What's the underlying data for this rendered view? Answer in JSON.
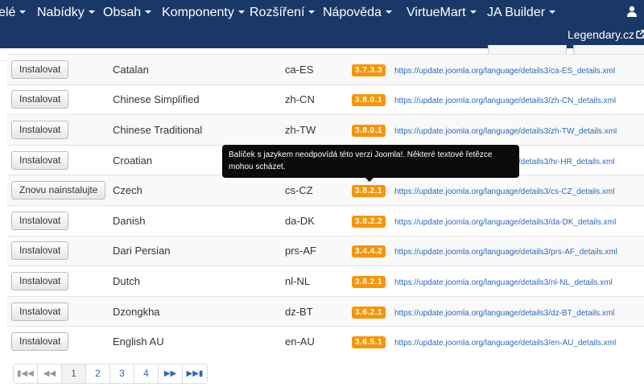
{
  "navbar": {
    "menu": [
      {
        "label": "elé",
        "caret": true
      },
      {
        "label": "Nabídky",
        "caret": true
      },
      {
        "label": "Obsah",
        "caret": true
      },
      {
        "label": "Komponenty",
        "caret": true
      },
      {
        "label": "Rozšíření",
        "caret": true
      },
      {
        "label": "Nápověda",
        "caret": true
      },
      {
        "label": "VirtueMart",
        "caret": true
      },
      {
        "label": "JA Builder",
        "caret": true
      }
    ],
    "user_icon": "user-icon",
    "site_link": "Legendary.cz",
    "site_link_icon": "external-link-icon"
  },
  "languages": [
    {
      "button": "Instalovat",
      "name": "Catalan",
      "tag": "ca-ES",
      "version": "3.7.3.3",
      "url": "https://update.joomla.org/language/details3/ca-ES_details.xml"
    },
    {
      "button": "Instalovat",
      "name": "Chinese Simplified",
      "tag": "zh-CN",
      "version": "3.8.0.1",
      "url": "https://update.joomla.org/language/details3/zh-CN_details.xml"
    },
    {
      "button": "Instalovat",
      "name": "Chinese Traditional",
      "tag": "zh-TW",
      "version": "3.8.0.1",
      "url": "https://update.joomla.org/language/details3/zh-TW_details.xml"
    },
    {
      "button": "Instalovat",
      "name": "Croatian",
      "tag": "",
      "version": "",
      "url": "https://update.joomla.org/language/details3/hr-HR_details.xml"
    },
    {
      "button": "Znovu nainstalujte",
      "name": "Czech",
      "tag": "cs-CZ",
      "version": "3.8.2.1",
      "url": "https://update.joomla.org/language/details3/cs-CZ_details.xml"
    },
    {
      "button": "Instalovat",
      "name": "Danish",
      "tag": "da-DK",
      "version": "3.8.2.2",
      "url": "https://update.joomla.org/language/details3/da-DK_details.xml"
    },
    {
      "button": "Instalovat",
      "name": "Dari Persian",
      "tag": "prs-AF",
      "version": "3.4.4.2",
      "url": "https://update.joomla.org/language/details3/prs-AF_details.xml"
    },
    {
      "button": "Instalovat",
      "name": "Dutch",
      "tag": "nl-NL",
      "version": "3.8.2.1",
      "url": "https://update.joomla.org/language/details3/nl-NL_details.xml"
    },
    {
      "button": "Instalovat",
      "name": "Dzongkha",
      "tag": "dz-BT",
      "version": "3.6.2.1",
      "url": "https://update.joomla.org/language/details3/dz-BT_details.xml"
    },
    {
      "button": "Instalovat",
      "name": "English AU",
      "tag": "en-AU",
      "version": "3.6.5.1",
      "url": "https://update.joomla.org/language/details3/en-AU_details.xml"
    }
  ],
  "tooltip": {
    "line1": "Balíček s jazykem neodpovídá této verzi Joomla!. Některé textové řetězce",
    "line2": "mohou scházet."
  },
  "pagination": {
    "first_icon": "first-page-icon",
    "prev_icon": "previous-page-icon",
    "pages": [
      "1",
      "2",
      "3",
      "4"
    ],
    "active_page": "1",
    "next_icon": "next-page-icon",
    "last_icon": "last-page-icon"
  },
  "colors": {
    "navbar": "#1a3867",
    "version_badge": "#f89406",
    "link": "#2a69b8",
    "tooltip": "#0b0b0b"
  }
}
